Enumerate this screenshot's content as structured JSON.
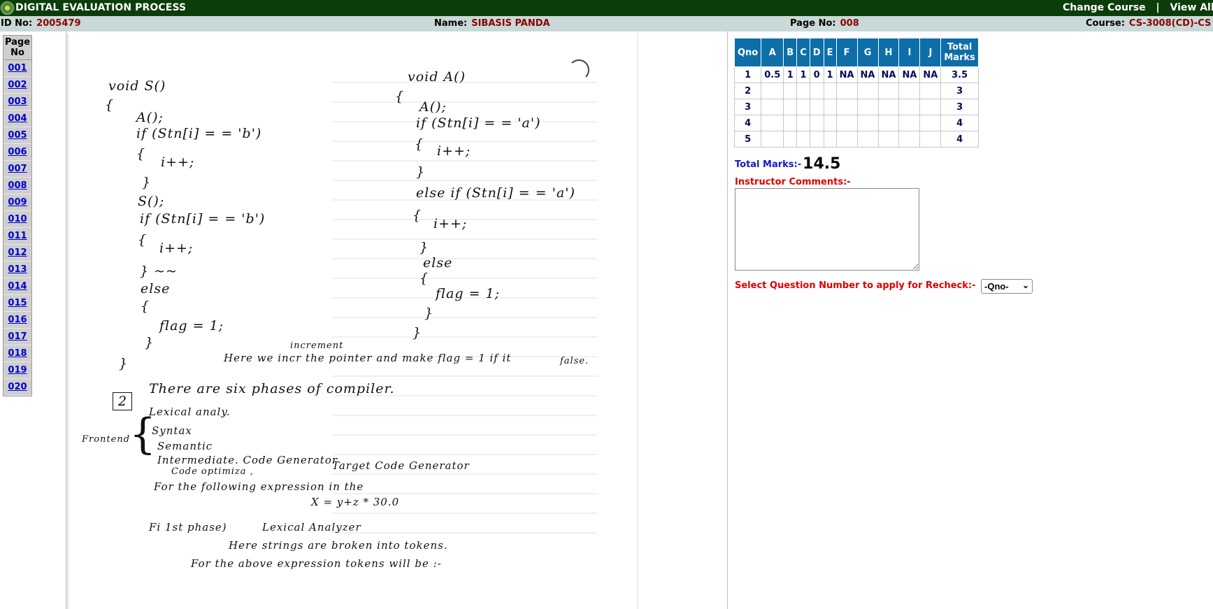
{
  "header": {
    "title": "DIGITAL EVALUATION PROCESS",
    "links": [
      "Change Course",
      "View All C"
    ],
    "separator": "|"
  },
  "info": {
    "id_label": "ID No:",
    "id_value": "2005479",
    "name_label": "Name:",
    "name_value": "SIBASIS PANDA",
    "page_label": "Page No:",
    "page_value": "008",
    "course_label": "Course:",
    "course_value": "CS-3008(CD)-CS"
  },
  "pagenav": {
    "header": "Page No",
    "pages": [
      "001",
      "002",
      "003",
      "004",
      "005",
      "006",
      "007",
      "008",
      "009",
      "010",
      "011",
      "012",
      "013",
      "014",
      "015",
      "016",
      "017",
      "018",
      "019",
      "020"
    ]
  },
  "sheet": {
    "lines": [
      "void S()",
      "{",
      "A();",
      "if (Stn[i] = = 'b')",
      "{",
      "i++;",
      "}",
      "S();",
      "if (Stn[i] = = 'b')",
      "{",
      "i++;",
      "} ~~",
      "else",
      "{",
      "flag = 1;",
      "}",
      "}",
      "void A()",
      "{",
      "A();",
      "if (Stn[i] = = 'a')",
      "{",
      "i++;",
      "}",
      "else if (Stn[i] = = 'a')",
      "{",
      "i++;",
      "}",
      "else",
      "{",
      "flag = 1;",
      "}",
      "}",
      "increment",
      "Here we incr the pointer and make flag = 1 if it",
      "false.",
      "2",
      "There are six phases of compiler.",
      "Lexical analy.",
      "Syntax",
      "Semantic",
      "Intermediate. Code Generator",
      "Code optimiza ,",
      "Target Code Generator",
      "Frontend",
      "For the following expression in the",
      "X = y+z * 30.0",
      "Fi 1st phase)",
      "Lexical Analyzer",
      "Here strings are broken into tokens.",
      "For the above expression tokens will be :-"
    ]
  },
  "marks": {
    "headers": [
      "Qno",
      "A",
      "B",
      "C",
      "D",
      "E",
      "F",
      "G",
      "H",
      "I",
      "J",
      "Total Marks"
    ],
    "rows": [
      [
        "1",
        "0.5",
        "1",
        "1",
        "0",
        "1",
        "NA",
        "NA",
        "NA",
        "NA",
        "NA",
        "3.5"
      ],
      [
        "2",
        "",
        "",
        "",
        "",
        "",
        "",
        "",
        "",
        "",
        "",
        "3"
      ],
      [
        "3",
        "",
        "",
        "",
        "",
        "",
        "",
        "",
        "",
        "",
        "",
        "3"
      ],
      [
        "4",
        "",
        "",
        "",
        "",
        "",
        "",
        "",
        "",
        "",
        "",
        "4"
      ],
      [
        "5",
        "",
        "",
        "",
        "",
        "",
        "",
        "",
        "",
        "",
        "",
        "4"
      ]
    ],
    "total_label": "Total Marks:-",
    "total_value": "14.5"
  },
  "comments": {
    "label": "Instructor Comments:-",
    "value": ""
  },
  "recheck": {
    "label": "Select Question Number to apply for Recheck:-",
    "selected": "-Qno-"
  }
}
